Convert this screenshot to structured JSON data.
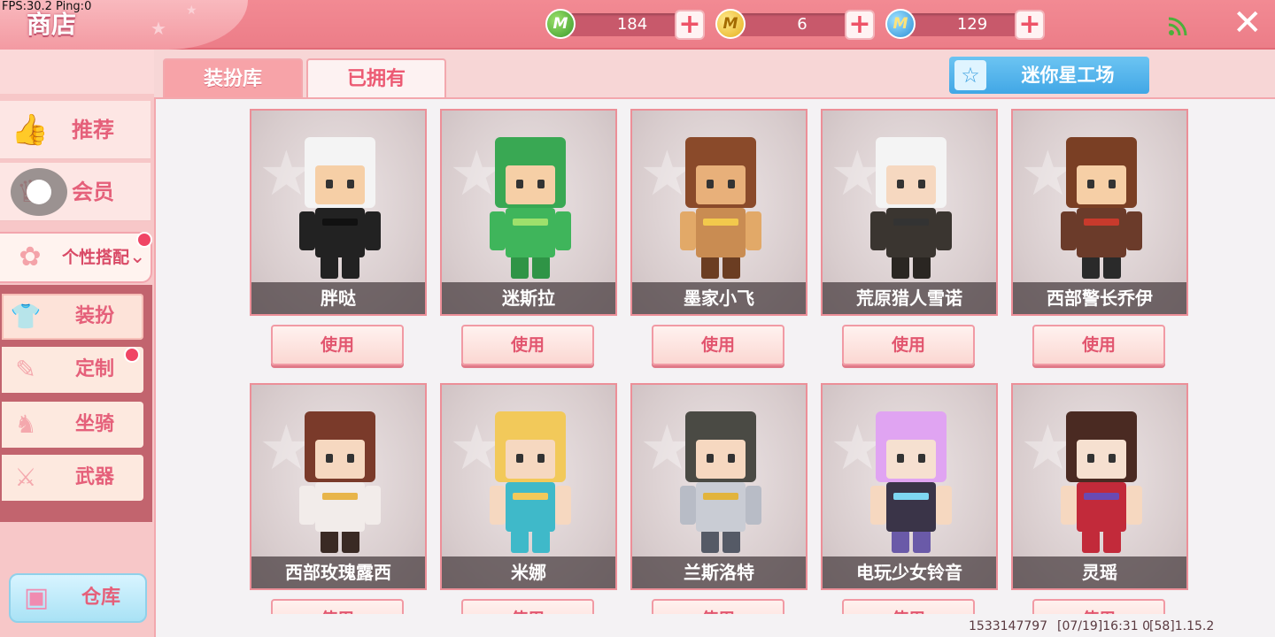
{
  "debug": "FPS:30.2  Ping:0",
  "title": "商店",
  "currencies": [
    {
      "icon": "green-gem-coin-icon",
      "letter": "M",
      "value": "184"
    },
    {
      "icon": "gold-coin-icon",
      "letter": "M",
      "value": "6"
    },
    {
      "icon": "blue-star-coin-icon",
      "letter": "M",
      "value": "129"
    }
  ],
  "close_glyph": "✕",
  "sidebar": {
    "items": [
      {
        "label": "推荐",
        "icon": "thumbs-up-icon"
      },
      {
        "label": "会员",
        "icon": "vip-icon"
      }
    ],
    "selected": {
      "label": "个性搭配",
      "chevron": "⌄"
    },
    "sub_items": [
      {
        "label": "装扮",
        "icon": "shirt-icon"
      },
      {
        "label": "定制",
        "icon": "pencil-icon"
      },
      {
        "label": "坐骑",
        "icon": "mount-icon"
      },
      {
        "label": "武器",
        "icon": "gun-icon"
      }
    ],
    "warehouse": {
      "label": "仓库",
      "icon": "chest-icon"
    }
  },
  "tabs": {
    "library": "装扮库",
    "owned": "已拥有"
  },
  "workshop": {
    "label": "迷你星工场",
    "icon": "star-icon"
  },
  "use_label": "使用",
  "skins": [
    {
      "name": "胖哒",
      "theme": "panda"
    },
    {
      "name": "迷斯拉",
      "theme": "dino"
    },
    {
      "name": "墨家小飞",
      "theme": "pilot"
    },
    {
      "name": "荒原猎人雪诺",
      "theme": "hunter"
    },
    {
      "name": "西部警长乔伊",
      "theme": "sheriff"
    },
    {
      "name": "西部玫瑰露西",
      "theme": "rose"
    },
    {
      "name": "米娜",
      "theme": "mermaid"
    },
    {
      "name": "兰斯洛特",
      "theme": "knight"
    },
    {
      "name": "电玩少女铃音",
      "theme": "gamer"
    },
    {
      "name": "灵瑶",
      "theme": "lingyao"
    }
  ],
  "footer": {
    "uid": "1533147797",
    "time": "[07/19]16:31 0",
    "version": "[58]1.15.2"
  },
  "colors": {
    "accent": "#ec7d88",
    "text_pink": "#e5607a",
    "workshop_blue": "#41a7e6"
  }
}
